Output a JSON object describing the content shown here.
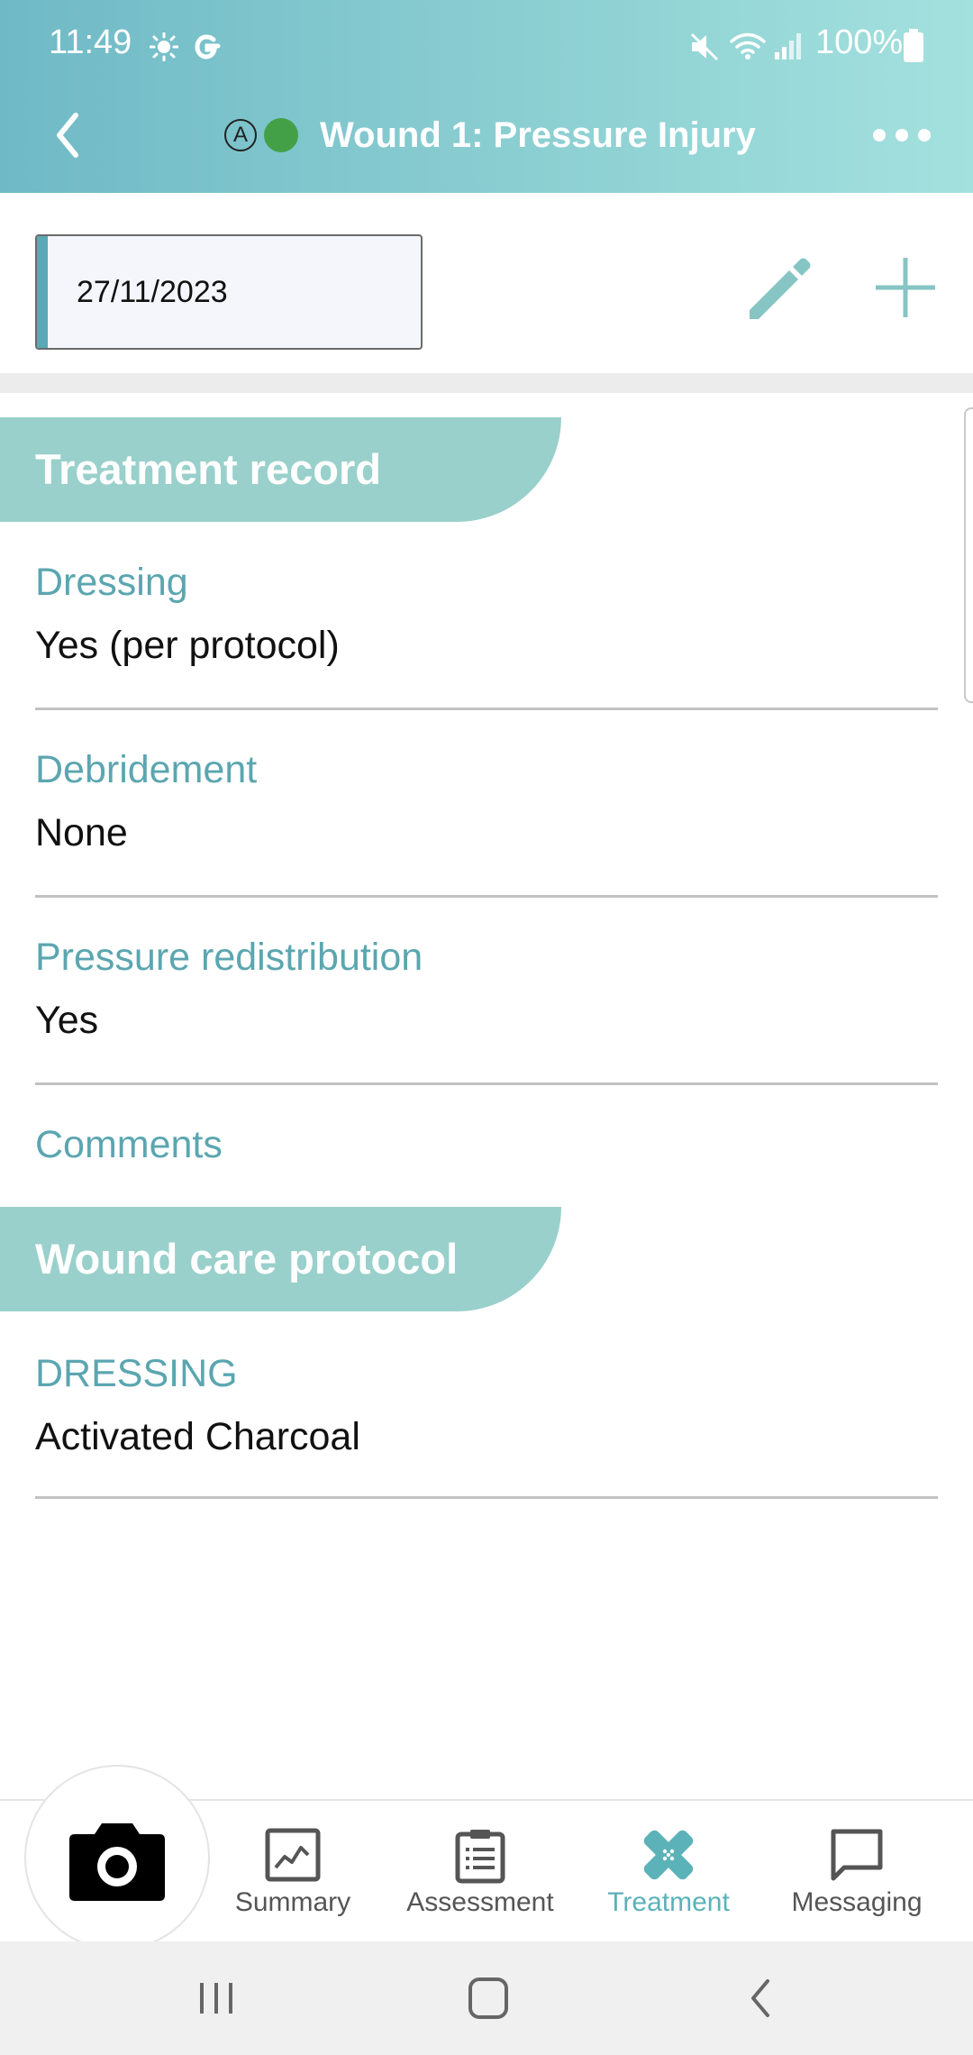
{
  "status_bar": {
    "time": "11:49",
    "battery": "100%",
    "icons": [
      "brightness-icon",
      "google-icon",
      "mute-icon",
      "wifi-icon",
      "signal-icon",
      "battery-icon"
    ]
  },
  "app_bar": {
    "title": "Wound 1: Pressure Injury",
    "badge_letter": "A",
    "status_dot_color": "#43a047"
  },
  "toolbar": {
    "date_value": "27/11/2023"
  },
  "treatment_record": {
    "heading": "Treatment record",
    "fields": [
      {
        "label": "Dressing",
        "value": "Yes (per protocol)"
      },
      {
        "label": "Debridement",
        "value": "None"
      },
      {
        "label": "Pressure redistribution",
        "value": "Yes"
      },
      {
        "label": "Comments",
        "value": ""
      }
    ]
  },
  "wound_care_protocol": {
    "heading": "Wound care protocol",
    "fields": [
      {
        "label": "DRESSING",
        "value": "Activated Charcoal"
      }
    ]
  },
  "bottom_nav": {
    "items": [
      {
        "label": "Summary",
        "icon": "chart-icon",
        "active": false
      },
      {
        "label": "Assessment",
        "icon": "clipboard-icon",
        "active": false
      },
      {
        "label": "Treatment",
        "icon": "bandage-icon",
        "active": true
      },
      {
        "label": "Messaging",
        "icon": "chat-icon",
        "active": false
      }
    ]
  },
  "colors": {
    "accent": "#5ba6b0",
    "section_header": "#99d0cb",
    "active_tab": "#5bb2b8"
  }
}
